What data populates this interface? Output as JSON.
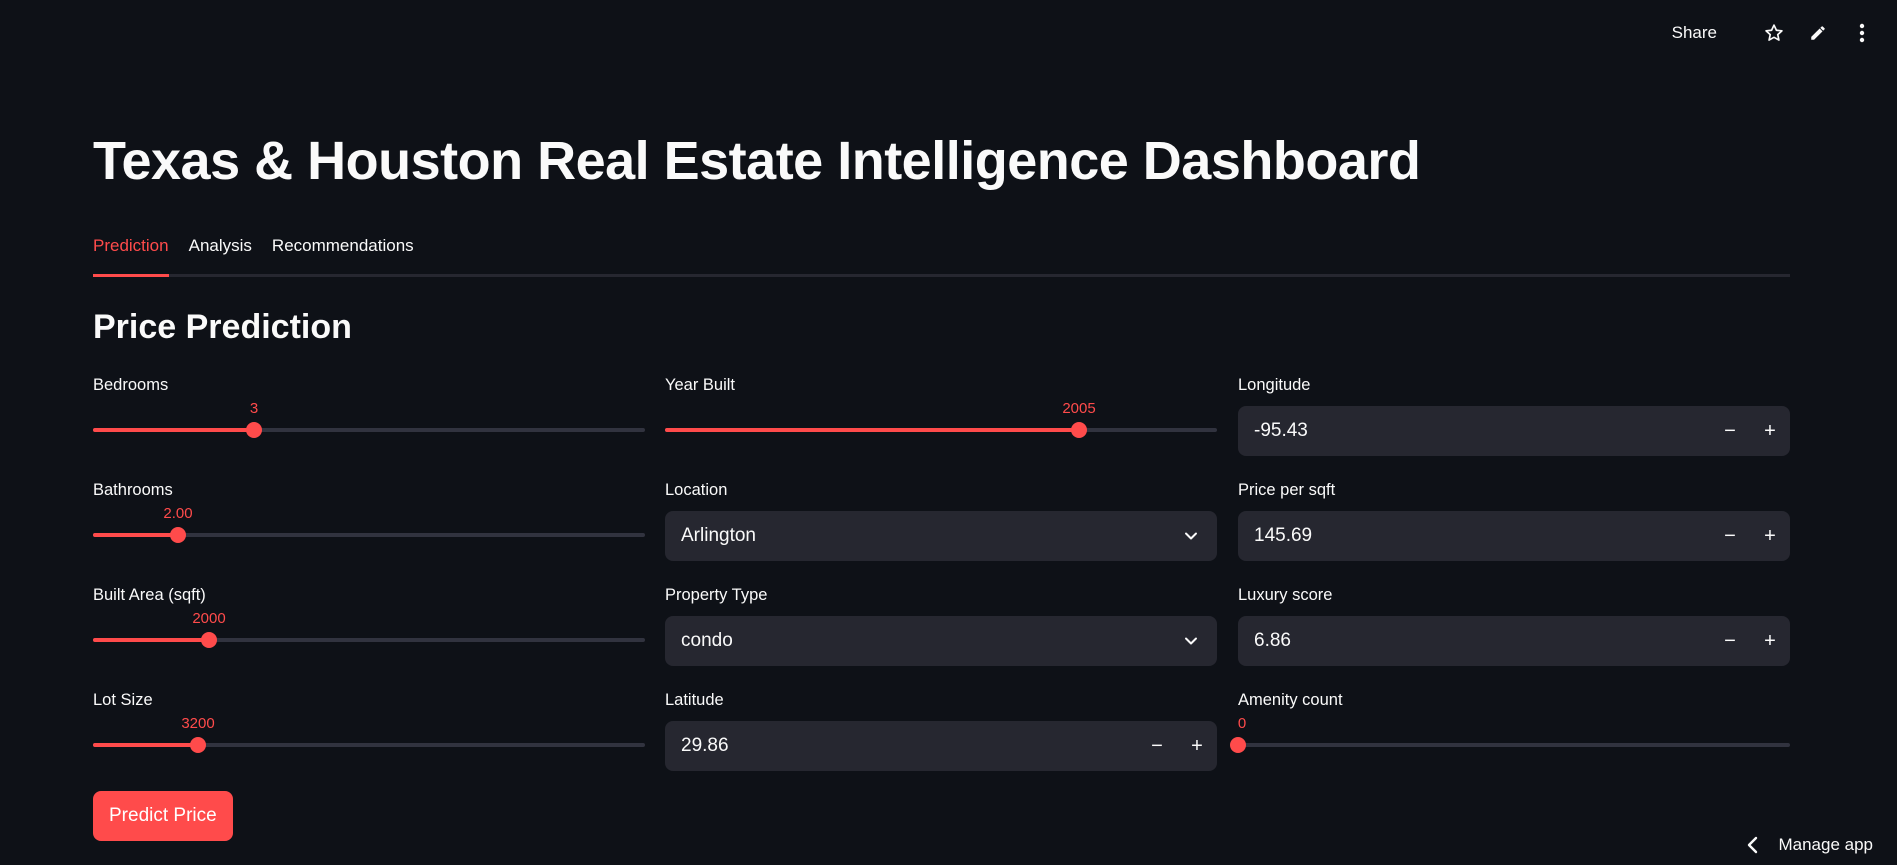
{
  "toolbar": {
    "share_label": "Share",
    "icons": [
      "star-icon",
      "pencil-icon",
      "more-vertical-icon"
    ]
  },
  "page": {
    "title": "Texas & Houston Real Estate Intelligence Dashboard"
  },
  "tabs": [
    {
      "label": "Prediction",
      "active": true
    },
    {
      "label": "Analysis",
      "active": false
    },
    {
      "label": "Recommendations",
      "active": false
    }
  ],
  "section": {
    "title": "Price Prediction"
  },
  "form": {
    "bedrooms": {
      "label": "Bedrooms",
      "value": "3",
      "fraction": 0.292
    },
    "bathrooms": {
      "label": "Bathrooms",
      "value": "2.00",
      "fraction": 0.154
    },
    "built_area": {
      "label": "Built Area (sqft)",
      "value": "2000",
      "fraction": 0.21
    },
    "lot_size": {
      "label": "Lot Size",
      "value": "3200",
      "fraction": 0.19
    },
    "year_built": {
      "label": "Year Built",
      "value": "2005",
      "fraction": 0.75
    },
    "location": {
      "label": "Location",
      "value": "Arlington"
    },
    "property_type": {
      "label": "Property Type",
      "value": "condo"
    },
    "latitude": {
      "label": "Latitude",
      "value": "29.86"
    },
    "longitude": {
      "label": "Longitude",
      "value": "-95.43"
    },
    "price_per_sqft": {
      "label": "Price per sqft",
      "value": "145.69"
    },
    "luxury_score": {
      "label": "Luxury score",
      "value": "6.86"
    },
    "amenity_count": {
      "label": "Amenity count",
      "value": "0",
      "fraction": 0.0
    }
  },
  "stepper": {
    "minus": "−",
    "plus": "+"
  },
  "predict_button": {
    "label": "Predict Price"
  },
  "manage_app": {
    "label": "Manage app"
  },
  "colors": {
    "accent": "#ff4b4b",
    "background": "#0e1117",
    "widget_bg": "#262730"
  }
}
